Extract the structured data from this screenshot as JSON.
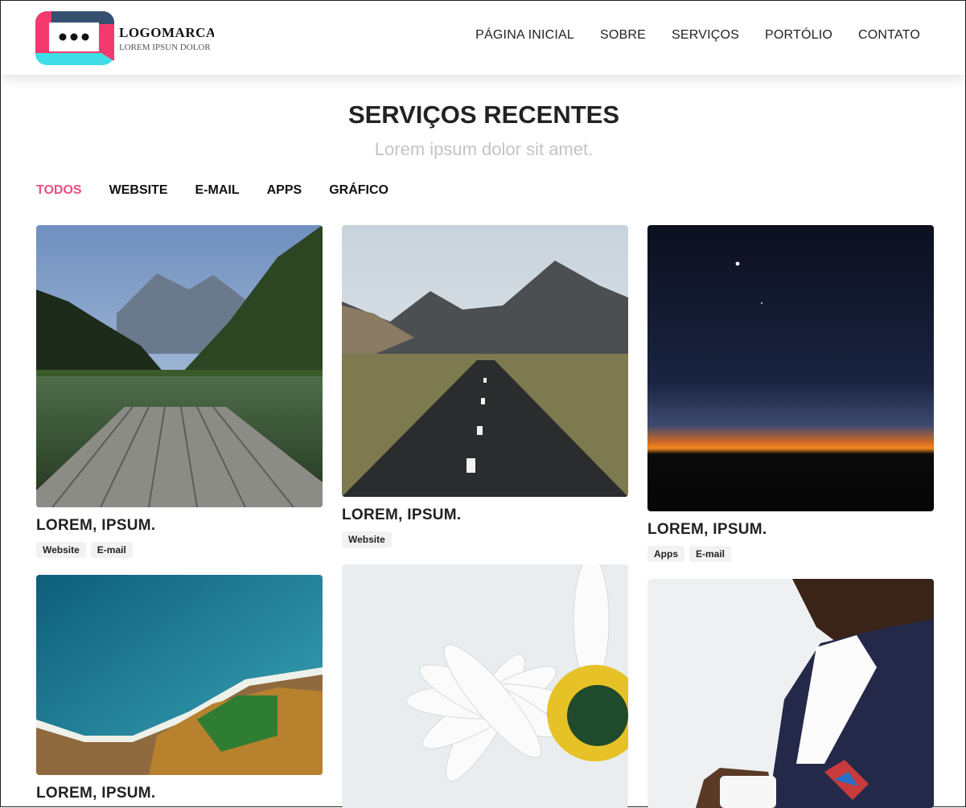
{
  "brand": {
    "title": "LOGOMARCA",
    "subtitle": "LOREM IPSUN DOLOR"
  },
  "nav": [
    "PÁGINA INICIAL",
    "SOBRE",
    "SERVIÇOS",
    "PORTÓLIO",
    "CONTATO"
  ],
  "section": {
    "title": "SERVIÇOS RECENTES",
    "subtitle": "Lorem ipsum dolor sit amet."
  },
  "filters": [
    "TODOS",
    "WEBSITE",
    "E-MAIL",
    "APPS",
    "GRÁFICO"
  ],
  "active_filter": "TODOS",
  "colors": {
    "accent": "#ee4c82",
    "logo_pink": "#f3396e",
    "logo_cyan": "#3fdde8",
    "logo_navy": "#34506e"
  },
  "cards": [
    {
      "title": "LOREM, IPSUM.",
      "tags": [
        "Website",
        "E-mail"
      ],
      "image": "lake-dock-mountains"
    },
    {
      "title": "LOREM, IPSUM.",
      "tags": [
        "Website"
      ],
      "image": "road-mountains"
    },
    {
      "title": "LOREM, IPSUM.",
      "tags": [
        "Apps",
        "E-mail"
      ],
      "image": "night-sky-sunset"
    },
    {
      "title": "LOREM, IPSUM.",
      "tags": [],
      "image": "aerial-coast"
    },
    {
      "title": "",
      "tags": [],
      "image": "white-daisy"
    },
    {
      "title": "",
      "tags": [],
      "image": "man-suit-coffee"
    }
  ]
}
